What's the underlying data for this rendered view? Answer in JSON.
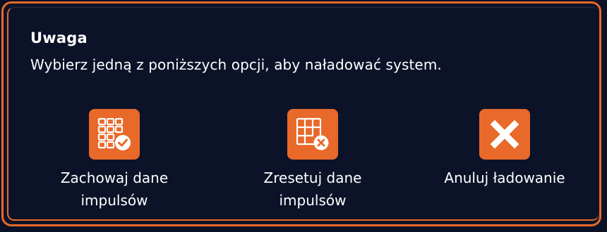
{
  "dialog": {
    "title": "Uwaga",
    "message": "Wybierz jedną z poniższych opcji, aby naładować system.",
    "options": [
      {
        "label_line1": "Zachowaj dane",
        "label_line2": "impulsów",
        "icon": "grid-check-icon"
      },
      {
        "label_line1": "Zresetuj dane",
        "label_line2": "impulsów",
        "icon": "grid-x-icon"
      },
      {
        "label_line1": "Anuluj ładowanie",
        "label_line2": "",
        "icon": "close-icon"
      }
    ]
  },
  "colors": {
    "accent": "#e8692a",
    "background": "#0c1328",
    "text": "#ffffff"
  }
}
